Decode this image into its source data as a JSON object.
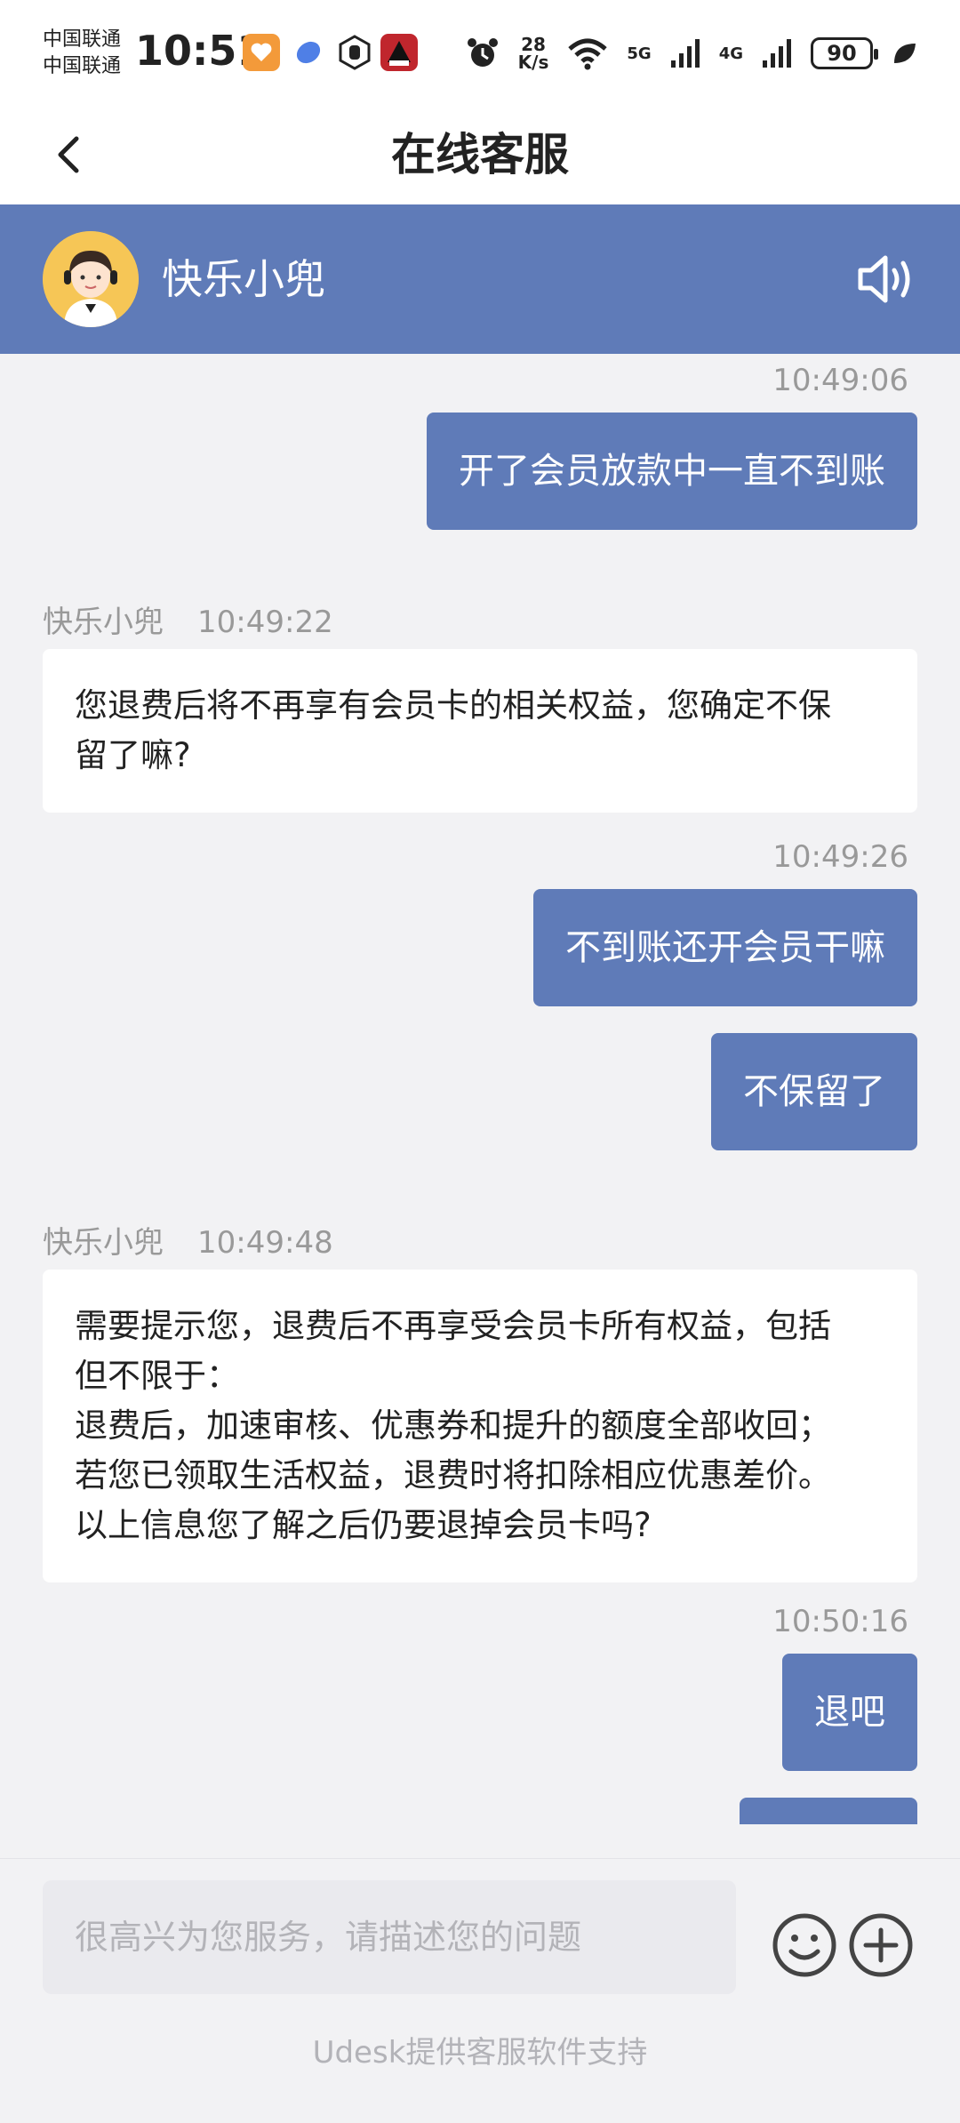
{
  "status": {
    "carrier_1": "中国联通",
    "carrier_2": "中国联通",
    "time": "10:51",
    "speed_value": "28",
    "speed_unit": "K/s",
    "net_1": "5G",
    "net_2": "4G",
    "battery": "90"
  },
  "header": {
    "title": "在线客服"
  },
  "agent": {
    "name": "快乐小兜"
  },
  "messages": {
    "m1": {
      "time": "10:49:06",
      "text": "开了会员放款中一直不到账"
    },
    "m2": {
      "sender": "快乐小兜",
      "time": "10:49:22",
      "line1": "您退费后将不再享有会员卡的相关权益，您确定不保",
      "line2": "留了嘛?"
    },
    "m3": {
      "time": "10:49:26",
      "text": "不到账还开会员干嘛"
    },
    "m4": {
      "text": "不保留了"
    },
    "m5": {
      "sender": "快乐小兜",
      "time": "10:49:48",
      "line1": "需要提示您，退费后不再享受会员卡所有权益，包括",
      "line2": "但不限于：",
      "line3": "退费后，加速审核、优惠券和提升的额度全部收回；",
      "line4": "若您已领取生活权益，退费时将扣除相应优惠差价。",
      "line5": "以上信息您了解之后仍要退掉会员卡吗?"
    },
    "m6": {
      "time": "10:50:16",
      "text": "退吧"
    }
  },
  "input": {
    "placeholder": "很高兴为您服务，请描述您的问题"
  },
  "footer": {
    "text": "Udesk提供客服软件支持"
  },
  "colors": {
    "accent": "#5f7bb8",
    "background": "#f2f2f4"
  },
  "icons": [
    "back-arrow-icon",
    "speaker-icon",
    "emoji-icon",
    "plus-icon",
    "alarm-icon",
    "wifi-icon",
    "signal-icon",
    "battery-icon",
    "leaf-icon"
  ]
}
